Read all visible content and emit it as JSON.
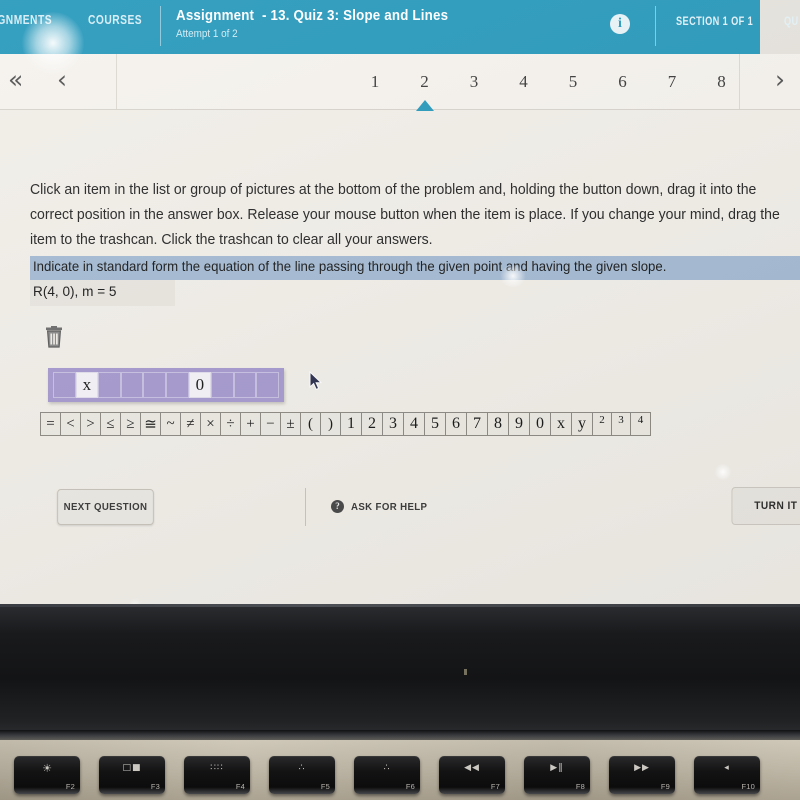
{
  "appbar": {
    "nav_assignments": "IGNMENTS",
    "nav_courses": "COURSES",
    "assignment_label": "Assignment",
    "assignment_title": "- 13. Quiz 3: Slope and Lines",
    "attempt": "Attempt 1 of 2",
    "info_icon_glyph": "i",
    "section": "SECTION 1 OF 1",
    "right_cut_label": "QU",
    "background_color": "#2c9bbd"
  },
  "pager": {
    "first_arrow": "«",
    "prev_arrow": "‹",
    "next_arrow": "›",
    "pages": [
      "1",
      "2",
      "3",
      "4",
      "5",
      "6",
      "7",
      "8"
    ],
    "selected_page": "2",
    "marker_color": "#2c9bbd"
  },
  "content": {
    "instructions": "Click an item in the list or group of pictures at the bottom of the problem and, holding the button down, drag it into the correct position in the answer box. Release your mouse button when the item is place. If you change your mind, drag the item to the trashcan. Click the trashcan to clear all your answers.",
    "problem_statement": "Indicate in standard form the equation of the line passing through the given point and having the given slope.",
    "given_values": "R(4, 0), m = 5",
    "problem_highlight_color": "#a6bcd4",
    "answer_box_color": "#a79bcf",
    "answer_cells": [
      "",
      "x",
      "",
      "",
      "",
      "",
      "0",
      "",
      "",
      ""
    ]
  },
  "palette": {
    "symbols": [
      "=",
      "<",
      ">",
      "≤",
      "≥",
      "≅",
      "~",
      "≠",
      "×",
      "÷",
      "+",
      "−",
      "±",
      "(",
      ")"
    ],
    "numbers": [
      "1",
      "2",
      "3",
      "4",
      "5",
      "6",
      "7",
      "8",
      "9",
      "0"
    ],
    "variables": [
      "x",
      "y"
    ],
    "exponents": [
      "2",
      "3",
      "4"
    ]
  },
  "actions": {
    "next_question": "NEXT QUESTION",
    "ask_for_help": "ASK FOR HELP",
    "help_icon_glyph": "?",
    "turn_it_in": "TURN IT IN"
  },
  "keyboard": {
    "keys": [
      {
        "label": "F2",
        "glyph": "☀",
        "small": false
      },
      {
        "label": "F3",
        "glyph": "□■",
        "small": true
      },
      {
        "label": "F4",
        "glyph": "∷∷",
        "small": true
      },
      {
        "label": "F5",
        "glyph": "∴",
        "small": true
      },
      {
        "label": "F6",
        "glyph": "∴",
        "small": true
      },
      {
        "label": "F7",
        "glyph": "◀◀",
        "small": true
      },
      {
        "label": "F8",
        "glyph": "▶‖",
        "small": true
      },
      {
        "label": "F9",
        "glyph": "▶▶",
        "small": true
      },
      {
        "label": "F10",
        "glyph": "◂",
        "small": true
      }
    ]
  }
}
